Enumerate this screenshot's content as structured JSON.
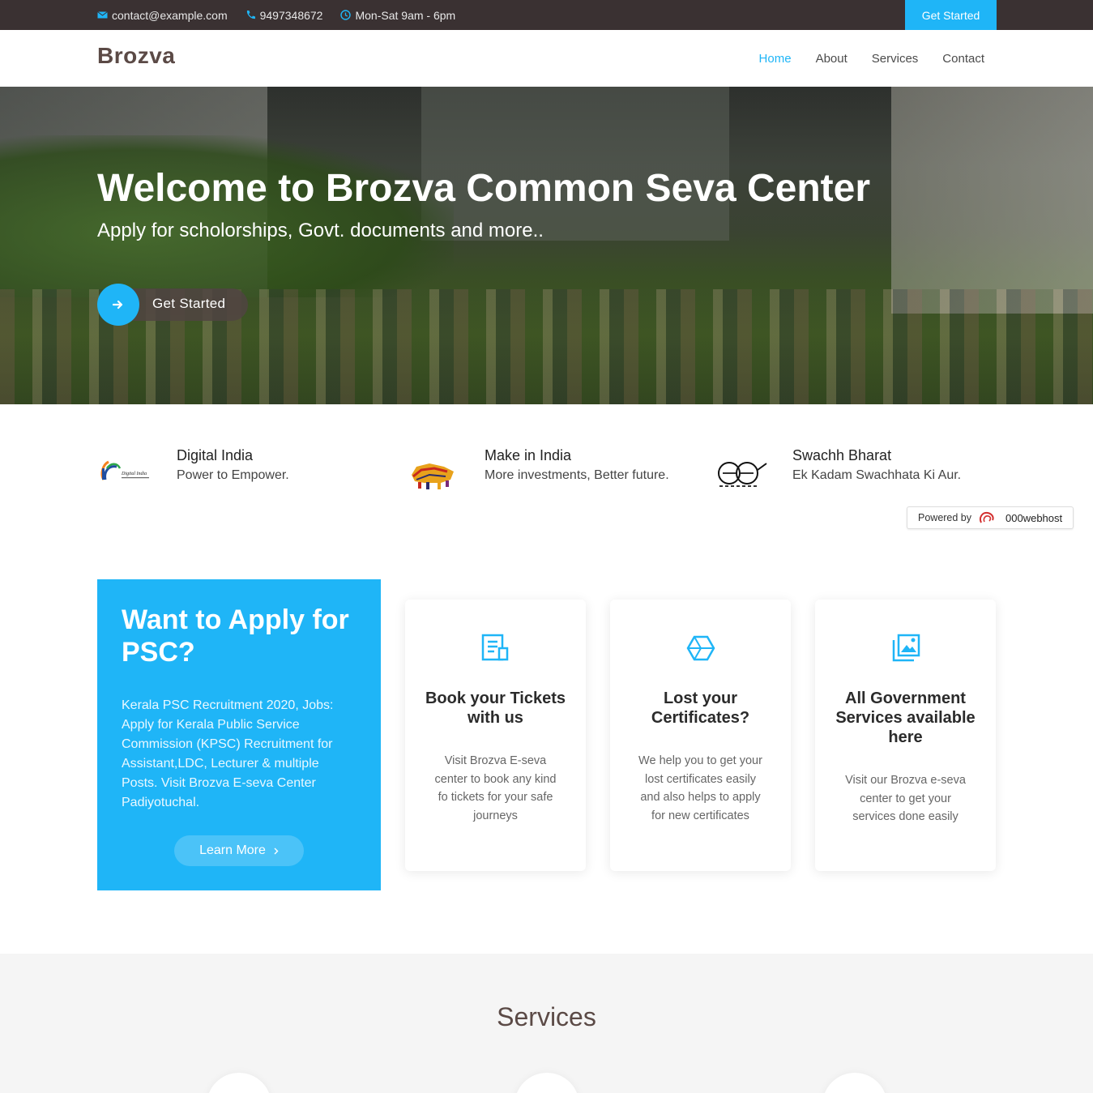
{
  "topbar": {
    "email": "contact@example.com",
    "phone": "9497348672",
    "hours": "Mon-Sat 9am - 6pm",
    "cta": "Get Started"
  },
  "header": {
    "logo": "Brozva",
    "nav": [
      "Home",
      "About",
      "Services",
      "Contact"
    ]
  },
  "hero": {
    "title": "Welcome to Brozva Common Seva Center",
    "subtitle": "Apply for scholorships, Govt. documents and more..",
    "button": "Get Started"
  },
  "initiatives": [
    {
      "title": "Digital India",
      "desc": "Power to Empower.",
      "logo_text": "Digital India"
    },
    {
      "title": "Make in India",
      "desc": "More investments, Better future."
    },
    {
      "title": "Swachh Bharat",
      "desc": "Ek Kadam Swachhata Ki Aur."
    }
  ],
  "powered": {
    "label": "Powered by",
    "brand": "000webhost"
  },
  "psc": {
    "title": "Want to Apply for PSC?",
    "text": "Kerala PSC Recruitment 2020, Jobs: Apply for Kerala Public Service Commission (KPSC) Recruitment for Assistant,LDC, Lecturer & multiple Posts. Visit Brozva E-seva Center Padiyotuchal.",
    "button": "Learn More"
  },
  "cards": [
    {
      "icon": "document-icon",
      "title": "Book your Tickets with us",
      "text": "Visit Brozva E-seva center to book any kind fo tickets for your safe journeys"
    },
    {
      "icon": "cube-icon",
      "title": "Lost your Certificates?",
      "text": "We help you to get your lost certificates easily and also helps to apply for new certificates"
    },
    {
      "icon": "images-icon",
      "title": "All Government Services available here",
      "text": "Visit our Brozva e-seva center to get your services done easily"
    }
  ],
  "services": {
    "title": "Services"
  },
  "colors": {
    "accent": "#1fb5f7",
    "topbar": "#3a3132",
    "logo": "#5b4a46"
  }
}
